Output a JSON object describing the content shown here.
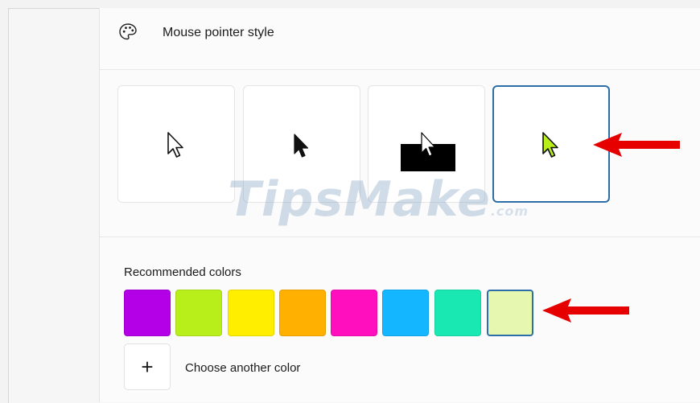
{
  "header": {
    "title": "Mouse pointer style",
    "icon": "palette-icon"
  },
  "pointer_styles": [
    {
      "name": "white",
      "icon": "white-arrow-cursor-icon",
      "selected": false
    },
    {
      "name": "black",
      "icon": "black-arrow-cursor-icon",
      "selected": false
    },
    {
      "name": "inverted",
      "icon": "inverted-arrow-cursor-icon",
      "selected": false
    },
    {
      "name": "custom",
      "icon": "custom-color-arrow-cursor-icon",
      "selected": true,
      "color": "#b8ee1a"
    }
  ],
  "colors_section": {
    "label": "Recommended colors",
    "swatches": [
      {
        "color": "#b300e6",
        "selected": false
      },
      {
        "color": "#b8ee1a",
        "selected": false
      },
      {
        "color": "#ffee00",
        "selected": false
      },
      {
        "color": "#ffb000",
        "selected": false
      },
      {
        "color": "#ff0fbe",
        "selected": false
      },
      {
        "color": "#14b6ff",
        "selected": false
      },
      {
        "color": "#19e8b2",
        "selected": false
      },
      {
        "color": "#e6f7b0",
        "selected": true
      }
    ],
    "add_button": {
      "symbol": "+",
      "label": "Choose another color"
    }
  },
  "annotations": {
    "arrow_color": "#e60000"
  },
  "watermark": {
    "text": "TipsMake",
    "suffix": ".com"
  }
}
